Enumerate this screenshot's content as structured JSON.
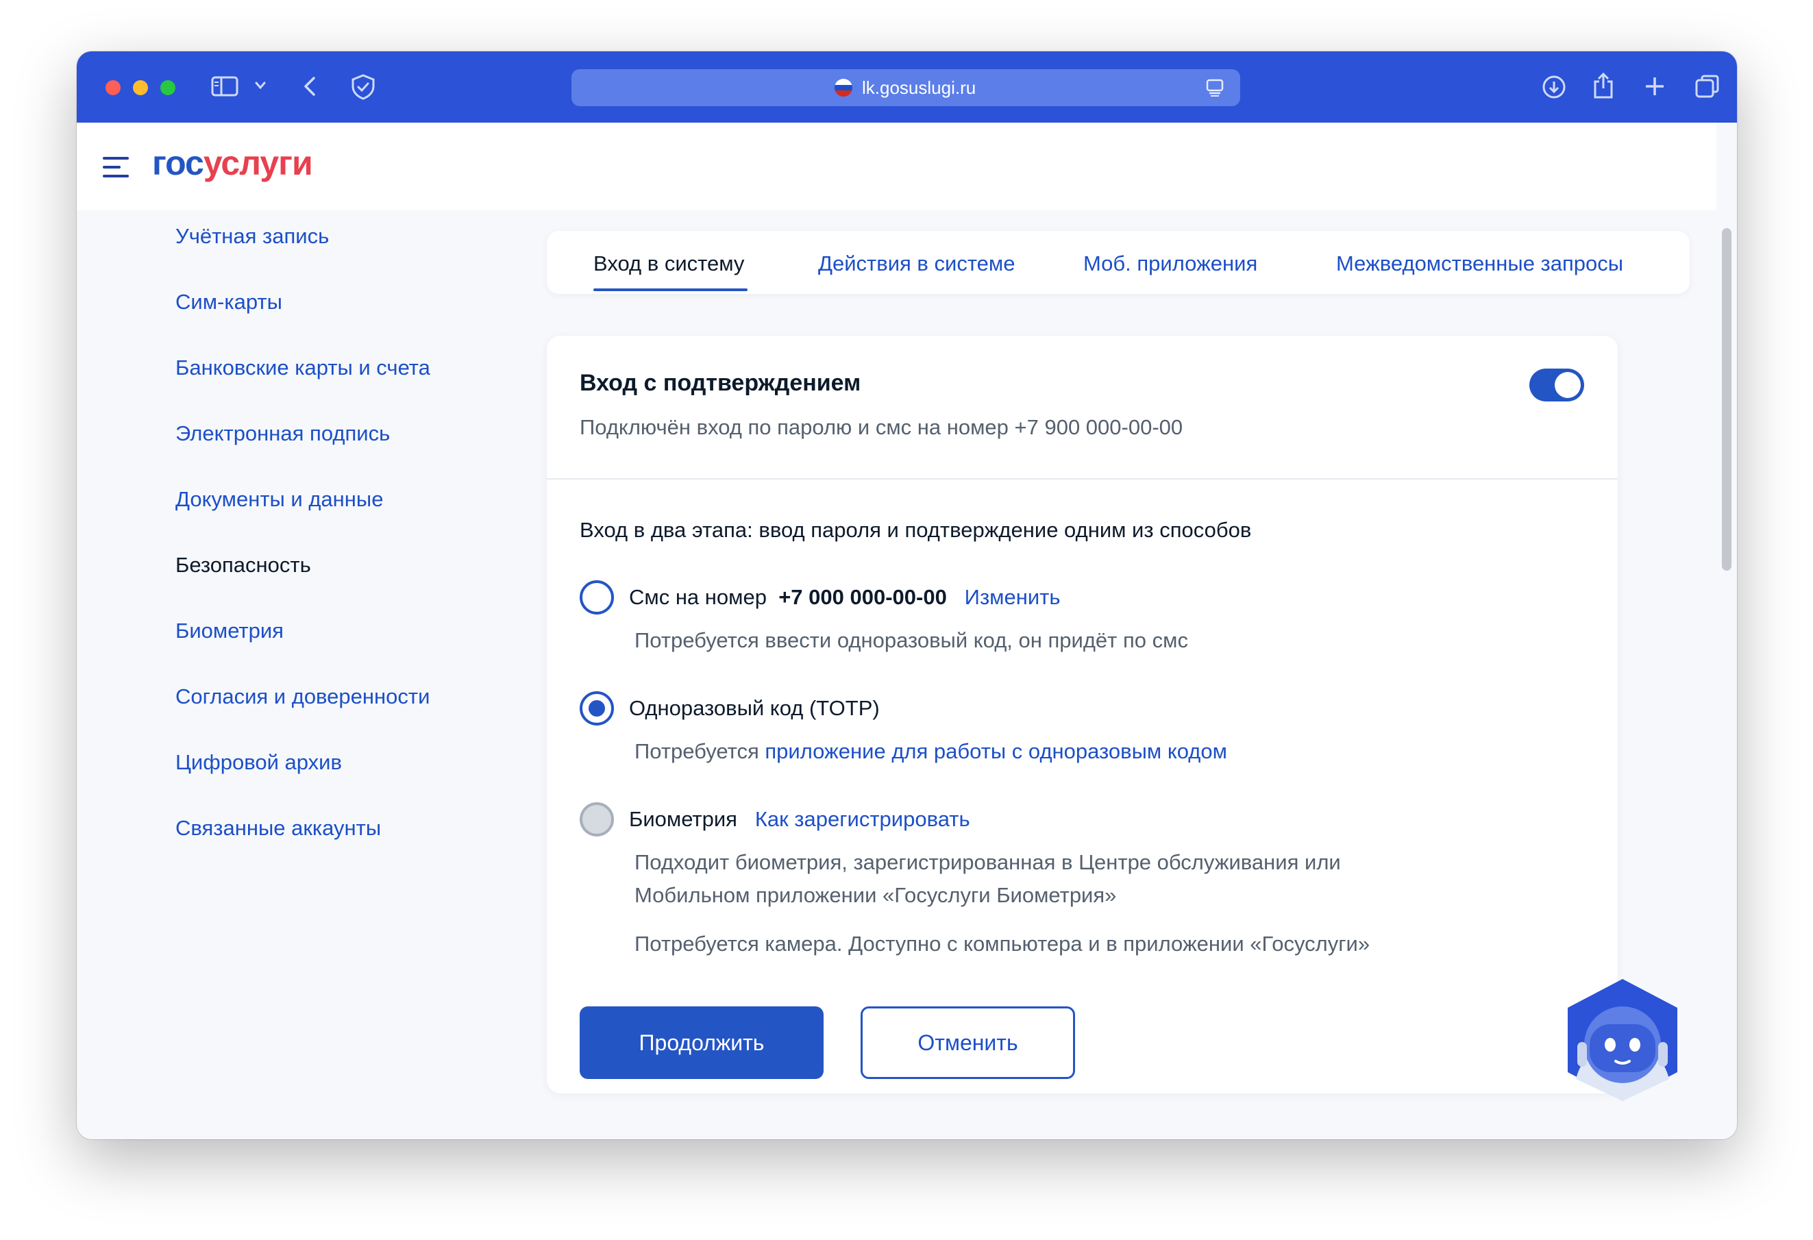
{
  "browser": {
    "url": "lk.gosuslugi.ru"
  },
  "header": {
    "logo_part1": "гос",
    "logo_part2": "услуги"
  },
  "sidebar": {
    "items": [
      {
        "label": "Учётная запись"
      },
      {
        "label": "Сим-карты"
      },
      {
        "label": "Банковские карты и счета"
      },
      {
        "label": "Электронная подпись"
      },
      {
        "label": "Документы и данные"
      },
      {
        "label": "Безопасность"
      },
      {
        "label": "Биометрия"
      },
      {
        "label": "Согласия и доверенности"
      },
      {
        "label": "Цифровой архив"
      },
      {
        "label": "Связанные аккаунты"
      }
    ],
    "active": "Безопасность"
  },
  "tabs": [
    {
      "label": "Вход в систему"
    },
    {
      "label": "Действия в системе"
    },
    {
      "label": "Моб. приложения"
    },
    {
      "label": "Межведомственные запросы"
    }
  ],
  "card": {
    "title": "Вход с подтверждением",
    "subtitle": "Подключён вход по паролю и смс на номер +7 900 000-00-00",
    "toggle_on": true,
    "section_title": "Вход в два этапа: ввод пароля и подтверждение одним из способов",
    "options": [
      {
        "label": "Смс на номер",
        "phone": "+7 000 000-00-00",
        "link": "Изменить",
        "description": "Потребуется ввести одноразовый код, он придёт по смс",
        "state": "unchecked"
      },
      {
        "label": "Одноразовый код (TOTP)",
        "description_prefix": "Потребуется",
        "description_link": "приложение для работы с одноразовым кодом",
        "state": "checked"
      },
      {
        "label": "Биометрия",
        "link": "Как зарегистрировать",
        "description_line1": "Подходит биометрия, зарегистрированная в Центре обслуживания или",
        "description_line2": "Мобильном приложении «Госуслуги Биометрия»",
        "description_line3": "Потребуется камера. Доступно с компьютера и в приложении «Госуслуги»",
        "state": "disabled"
      }
    ],
    "continue_button": "Продолжить",
    "cancel_button": "Отменить"
  },
  "colors": {
    "toolbar": "#2b52d7",
    "brand_blue": "#2455c4",
    "brand_red": "#e8404f",
    "link": "#1c4fc7",
    "text": "#0d1a2b",
    "muted": "#55606e"
  }
}
